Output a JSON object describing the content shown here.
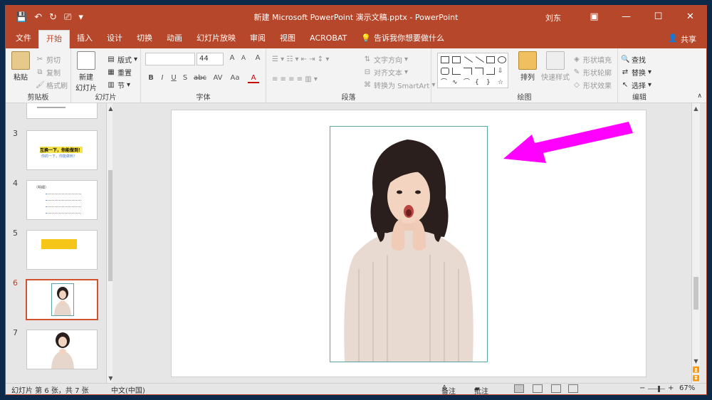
{
  "window": {
    "title": "新建 Microsoft PowerPoint 演示文稿.pptx  -  PowerPoint",
    "user": "刘东",
    "controls": {
      "ribbon_display": "▣",
      "minimize": "—",
      "maximize": "☐",
      "close": "✕"
    }
  },
  "qat": {
    "save": "💾",
    "undo": "↶",
    "redo": "↻",
    "present": "⎚",
    "customize": "▾"
  },
  "tabs": [
    {
      "label": "文件"
    },
    {
      "label": "开始"
    },
    {
      "label": "插入"
    },
    {
      "label": "设计"
    },
    {
      "label": "切换"
    },
    {
      "label": "动画"
    },
    {
      "label": "幻灯片放映"
    },
    {
      "label": "审阅"
    },
    {
      "label": "视图"
    },
    {
      "label": "ACROBAT"
    }
  ],
  "tellme": {
    "icon": "💡",
    "text": "告诉我你想要做什么"
  },
  "share": {
    "icon": "👤",
    "label": "共享"
  },
  "ribbon": {
    "clipboard": {
      "label": "剪贴板",
      "paste": "粘贴",
      "cut": "剪切",
      "copy": "复制",
      "format_painter": "格式刷"
    },
    "slides": {
      "label": "幻灯片",
      "new_slide_1": "新建",
      "new_slide_2": "幻灯片",
      "layout": "版式",
      "reset": "重置",
      "section": "节"
    },
    "font": {
      "label": "字体",
      "font_name": "",
      "font_size": "44",
      "bold": "B",
      "italic": "I",
      "underline": "U",
      "strike": "S",
      "shadow": "abc",
      "spacing": "AV",
      "case": "Aa",
      "grow": "A",
      "shrink": "A",
      "clear": "A",
      "color": "A"
    },
    "paragraph": {
      "label": "段落",
      "text_direction": "文字方向",
      "align_text": "对齐文本",
      "smartart": "转换为 SmartArt"
    },
    "drawing": {
      "label": "绘图",
      "arrange": "排列",
      "quick_styles": "快速样式",
      "shape_fill": "形状填充",
      "shape_outline": "形状轮廓",
      "shape_effects": "形状效果"
    },
    "editing": {
      "label": "编辑",
      "find": "查找",
      "replace": "替换",
      "select": "选择"
    }
  },
  "thumbnails": [
    {
      "num": "3",
      "line1": "互换一下，你能做到！",
      "line2": "你的一下，你能做到！"
    },
    {
      "num": "4",
      "line1": "（明细）"
    },
    {
      "num": "5"
    },
    {
      "num": "6"
    },
    {
      "num": "7"
    }
  ],
  "statusbar": {
    "slide_info": "幻灯片 第 6 张，共 7 张",
    "language": "中文(中国)",
    "notes": "备注",
    "comments": "批注",
    "zoom": "67%",
    "zoom_out": "−",
    "zoom_in": "+"
  },
  "colors": {
    "accent": "#b7472a",
    "arrow": "#ff00ff",
    "selection": "#d35230",
    "picture_border": "#5aa3a8",
    "thumb_bar": "#f5c518"
  }
}
